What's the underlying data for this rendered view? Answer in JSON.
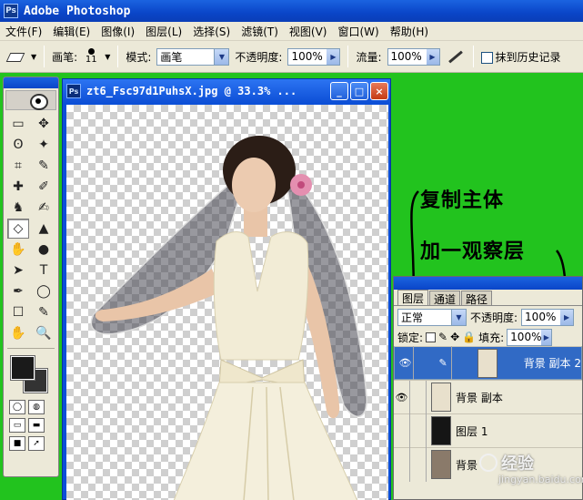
{
  "app": {
    "title": "Adobe Photoshop",
    "logo_text": "Ps"
  },
  "menu": [
    "文件(F)",
    "编辑(E)",
    "图像(I)",
    "图层(L)",
    "选择(S)",
    "滤镜(T)",
    "视图(V)",
    "窗口(W)",
    "帮助(H)"
  ],
  "options": {
    "brush_label": "画笔:",
    "brush_size": "11",
    "mode_label": "模式:",
    "mode_value": "画笔",
    "opacity_label": "不透明度:",
    "opacity_value": "100%",
    "flow_label": "流量:",
    "flow_value": "100%",
    "history_label": "抹到历史记录"
  },
  "document": {
    "title": "zt6_Fsc97d1PuhsX.jpg @ 33.3% ...",
    "icon_text": "Ps",
    "minimize": "_",
    "maximize": "□",
    "close": "×"
  },
  "toolbox": {
    "tools": [
      "▭",
      "✥",
      "ʘ",
      "✦",
      "⌗",
      "✎",
      "✚",
      "✐",
      "♞",
      "✍",
      "◇",
      "▲",
      "✋",
      "●",
      "➤",
      "T",
      "✒",
      "◯",
      "☐",
      "✎",
      "✋",
      "🔍"
    ]
  },
  "layers_panel": {
    "tabs": [
      "图层",
      "通道",
      "路径"
    ],
    "blend_mode": "正常",
    "opacity_label": "不透明度:",
    "opacity_value": "100%",
    "lock_label": "锁定:",
    "fill_label": "填充:",
    "fill_value": "100%",
    "layers": [
      {
        "name": "背景 副本 2",
        "visible": true,
        "selected": true
      },
      {
        "name": "背景 副本",
        "visible": true,
        "selected": false
      },
      {
        "name": "图层 1",
        "visible": false,
        "selected": false
      },
      {
        "name": "背景",
        "visible": false,
        "selected": false
      }
    ]
  },
  "annotations": {
    "copy_subject": "复制主体",
    "add_observation_layer": "加一观察层"
  },
  "watermark": {
    "text": "经验",
    "sub": "jingyan.baidu.com"
  }
}
